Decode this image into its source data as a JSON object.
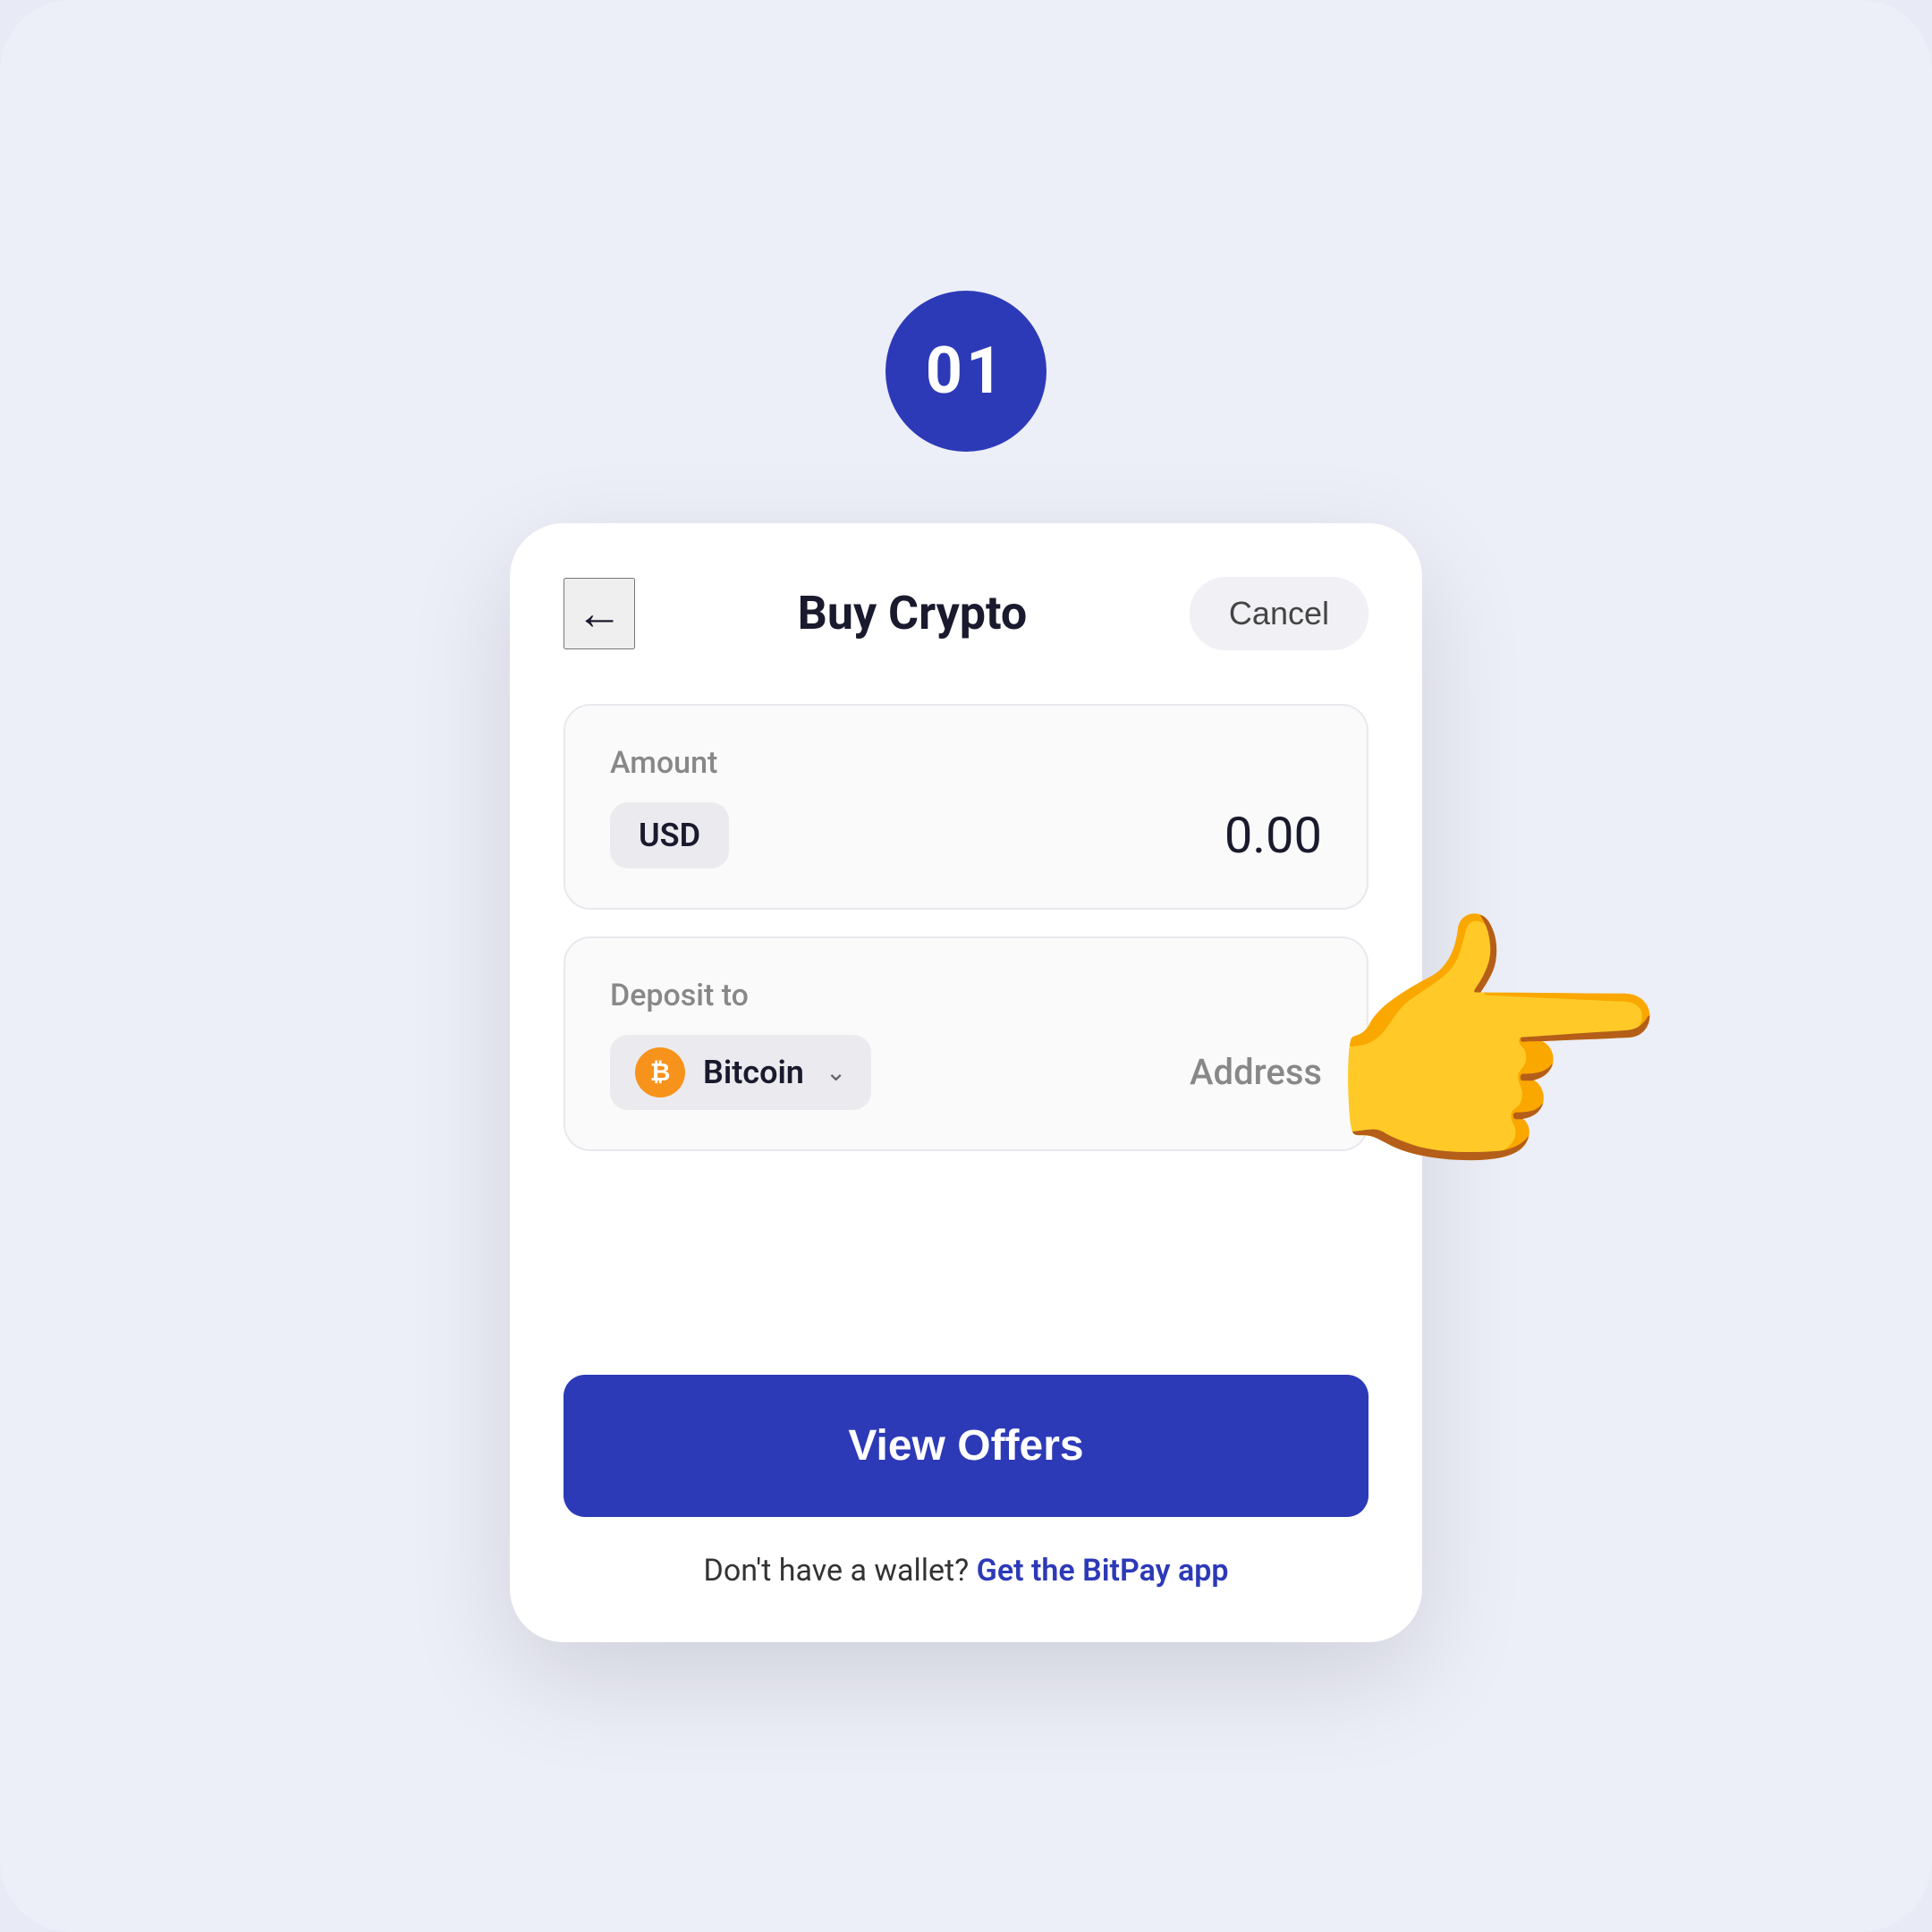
{
  "step": {
    "number": "01"
  },
  "header": {
    "title": "Buy Crypto",
    "cancel_label": "Cancel"
  },
  "amount_section": {
    "label": "Amount",
    "currency": "USD",
    "value": "0.00"
  },
  "deposit_section": {
    "label": "Deposit to",
    "crypto_name": "Bitcoin",
    "address_label": "Address"
  },
  "footer": {
    "view_offers_label": "View Offers",
    "wallet_prompt": "Don't have a wallet?",
    "wallet_link": "Get the BitPay app"
  },
  "icons": {
    "back": "←",
    "chevron_down": "⌄",
    "bitcoin": "₿"
  }
}
